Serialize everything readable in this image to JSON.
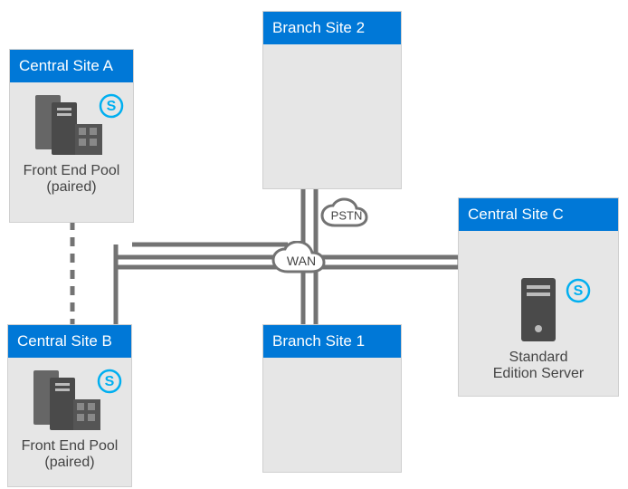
{
  "sites": {
    "csa": {
      "title": "Central Site A",
      "caption1": "Front End Pool",
      "caption2": "(paired)"
    },
    "csb": {
      "title": "Central Site B",
      "caption1": "Front End Pool",
      "caption2": "(paired)"
    },
    "csc": {
      "title": "Central Site C",
      "caption1": "Standard",
      "caption2": "Edition Server"
    },
    "b1": {
      "title": "Branch Site 1"
    },
    "b2": {
      "title": "Branch Site 2"
    }
  },
  "clouds": {
    "wan": {
      "label": "WAN"
    },
    "pstn": {
      "label": "PSTN"
    }
  },
  "colors": {
    "accent": "#0078d7",
    "line": "#737373"
  }
}
